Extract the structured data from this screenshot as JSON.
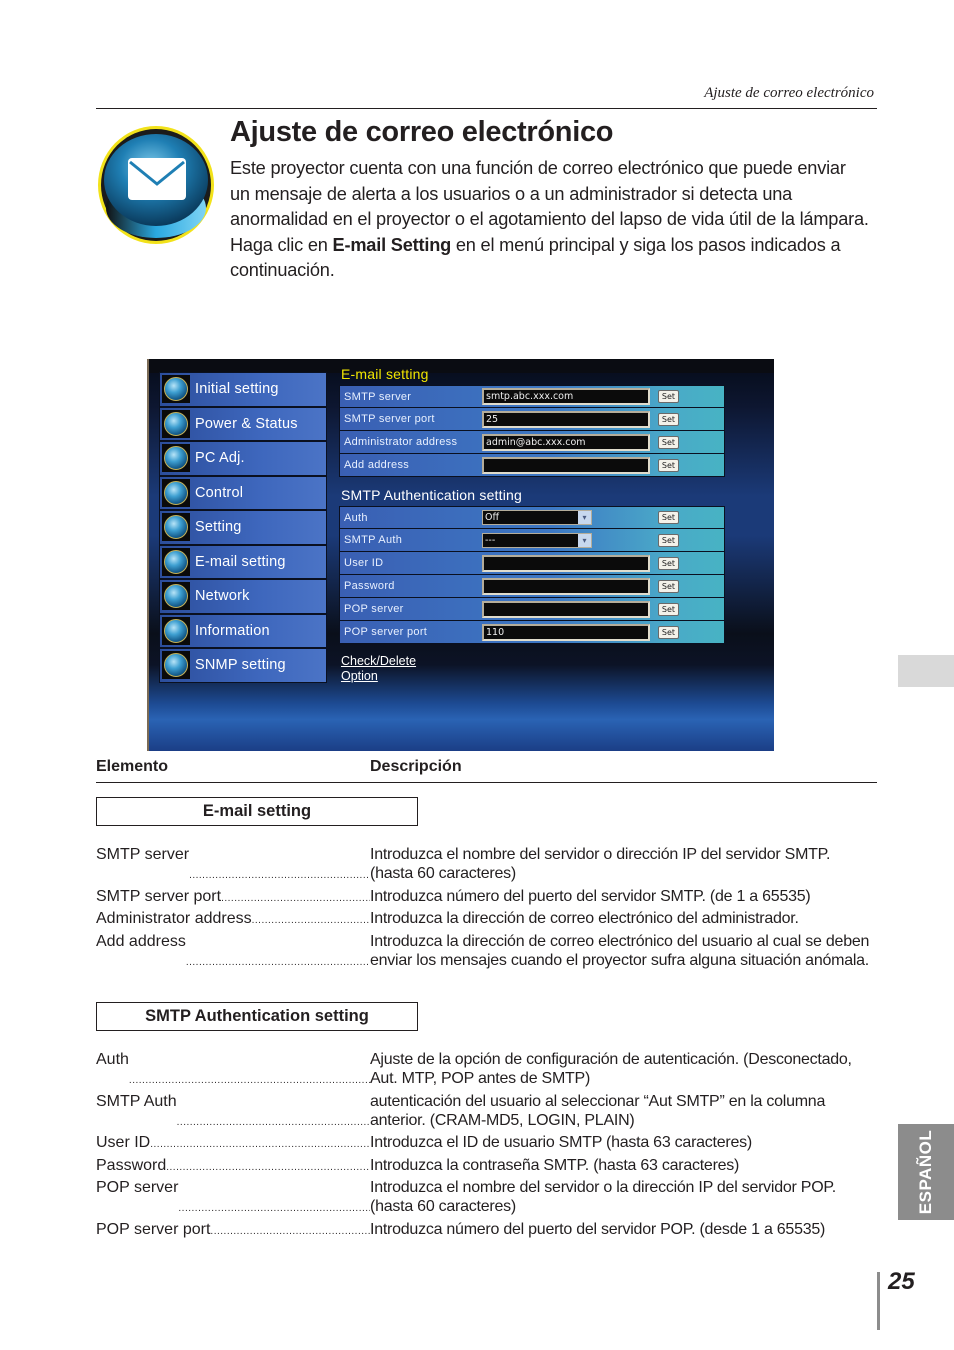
{
  "running_head": "Ajuste de correo electrónico",
  "hero": {
    "icon": "envelope-icon",
    "title": "Ajuste de correo electrónico",
    "text_before": "Este proyector cuenta con una función de correo electrónico que puede enviar un mensaje de alerta a los usuarios o a un administrador si detecta una anormalidad en el proyector o el agotamiento del lapso de vida útil de la lámpara. Haga clic en ",
    "text_bold": "E-mail Setting",
    "text_after": " en el menú principal y siga los pasos indicados a continuación."
  },
  "screenshot": {
    "nav": [
      {
        "label": "Initial setting",
        "icon": "initial-setting-icon"
      },
      {
        "label": "Power & Status",
        "icon": "power-status-icon"
      },
      {
        "label": "PC Adj.",
        "icon": "pc-adj-icon"
      },
      {
        "label": "Control",
        "icon": "control-icon"
      },
      {
        "label": "Setting",
        "icon": "setting-icon"
      },
      {
        "label": "E-mail setting",
        "icon": "email-icon"
      },
      {
        "label": "Network",
        "icon": "network-icon"
      },
      {
        "label": "Information",
        "icon": "information-icon"
      },
      {
        "label": "SNMP setting",
        "icon": "snmp-icon"
      }
    ],
    "email_section": {
      "title": "E-mail setting",
      "title_color": "#f2e600",
      "rows": [
        {
          "label": "SMTP server",
          "value": "smtp.abc.xxx.com"
        },
        {
          "label": "SMTP server port",
          "value": "25"
        },
        {
          "label": "Administrator address",
          "value": "admin@abc.xxx.com"
        },
        {
          "label": "Add address",
          "value": ""
        }
      ]
    },
    "auth_section": {
      "title": "SMTP Authentication setting",
      "title_color": "#ffffff",
      "selects": [
        {
          "label": "Auth",
          "value": "Off"
        },
        {
          "label": "SMTP Auth",
          "value": "---"
        }
      ],
      "rows": [
        {
          "label": "User ID",
          "value": ""
        },
        {
          "label": "Password",
          "value": ""
        },
        {
          "label": "POP server",
          "value": ""
        },
        {
          "label": "POP server port",
          "value": "110"
        }
      ]
    },
    "set_label": "Set",
    "dropdown_arrow": "▾",
    "links": [
      "Check/Delete",
      "Option"
    ]
  },
  "table": {
    "col_item": "Elemento",
    "col_desc": "Descripción",
    "dots": "................................................................................................................................",
    "sections": [
      {
        "title": "E-mail setting",
        "entries": [
          {
            "term": "SMTP server",
            "desc": "Introduzca el nombre del servidor o dirección IP del servidor SMTP. (hasta 60 caracteres)"
          },
          {
            "term": "SMTP server port ",
            "desc": "Introduzca número del puerto del servidor SMTP. (de 1 a 65535)"
          },
          {
            "term": "Administrator address ",
            "desc": "Introduzca la dirección de correo electrónico del administrador."
          },
          {
            "term": "Add address",
            "desc": "Introduzca la dirección de correo electrónico del usuario al cual se deben enviar los mensajes cuando el proyector sufra alguna situación anómala."
          }
        ]
      },
      {
        "title": "SMTP Authentication setting",
        "entries": [
          {
            "term": "Auth ",
            "desc": "Ajuste de la opción de configuración de autenticación. (Desconectado, Aut. MTP, POP antes de SMTP)"
          },
          {
            "term": "SMTP Auth ",
            "desc": "autenticación del usuario al seleccionar “Aut SMTP” en la columna anterior. (CRAM-MD5, LOGIN, PLAIN)"
          },
          {
            "term": "User ID",
            "desc": "Introduzca el ID de usuario SMTP (hasta 63 caracteres)"
          },
          {
            "term": "Password ",
            "desc": "Introduzca la contraseña SMTP. (hasta 63 caracteres)"
          },
          {
            "term": "POP server",
            "desc": "Introduzca el nombre del servidor o la dirección IP del servidor POP. (hasta 60 caracteres)"
          },
          {
            "term": "POP server port ",
            "desc": "Introduzca número del puerto del servidor POP. (desde 1 a 65535)"
          }
        ]
      }
    ]
  },
  "side_tab": "ESPAÑOL",
  "page_number": "25"
}
